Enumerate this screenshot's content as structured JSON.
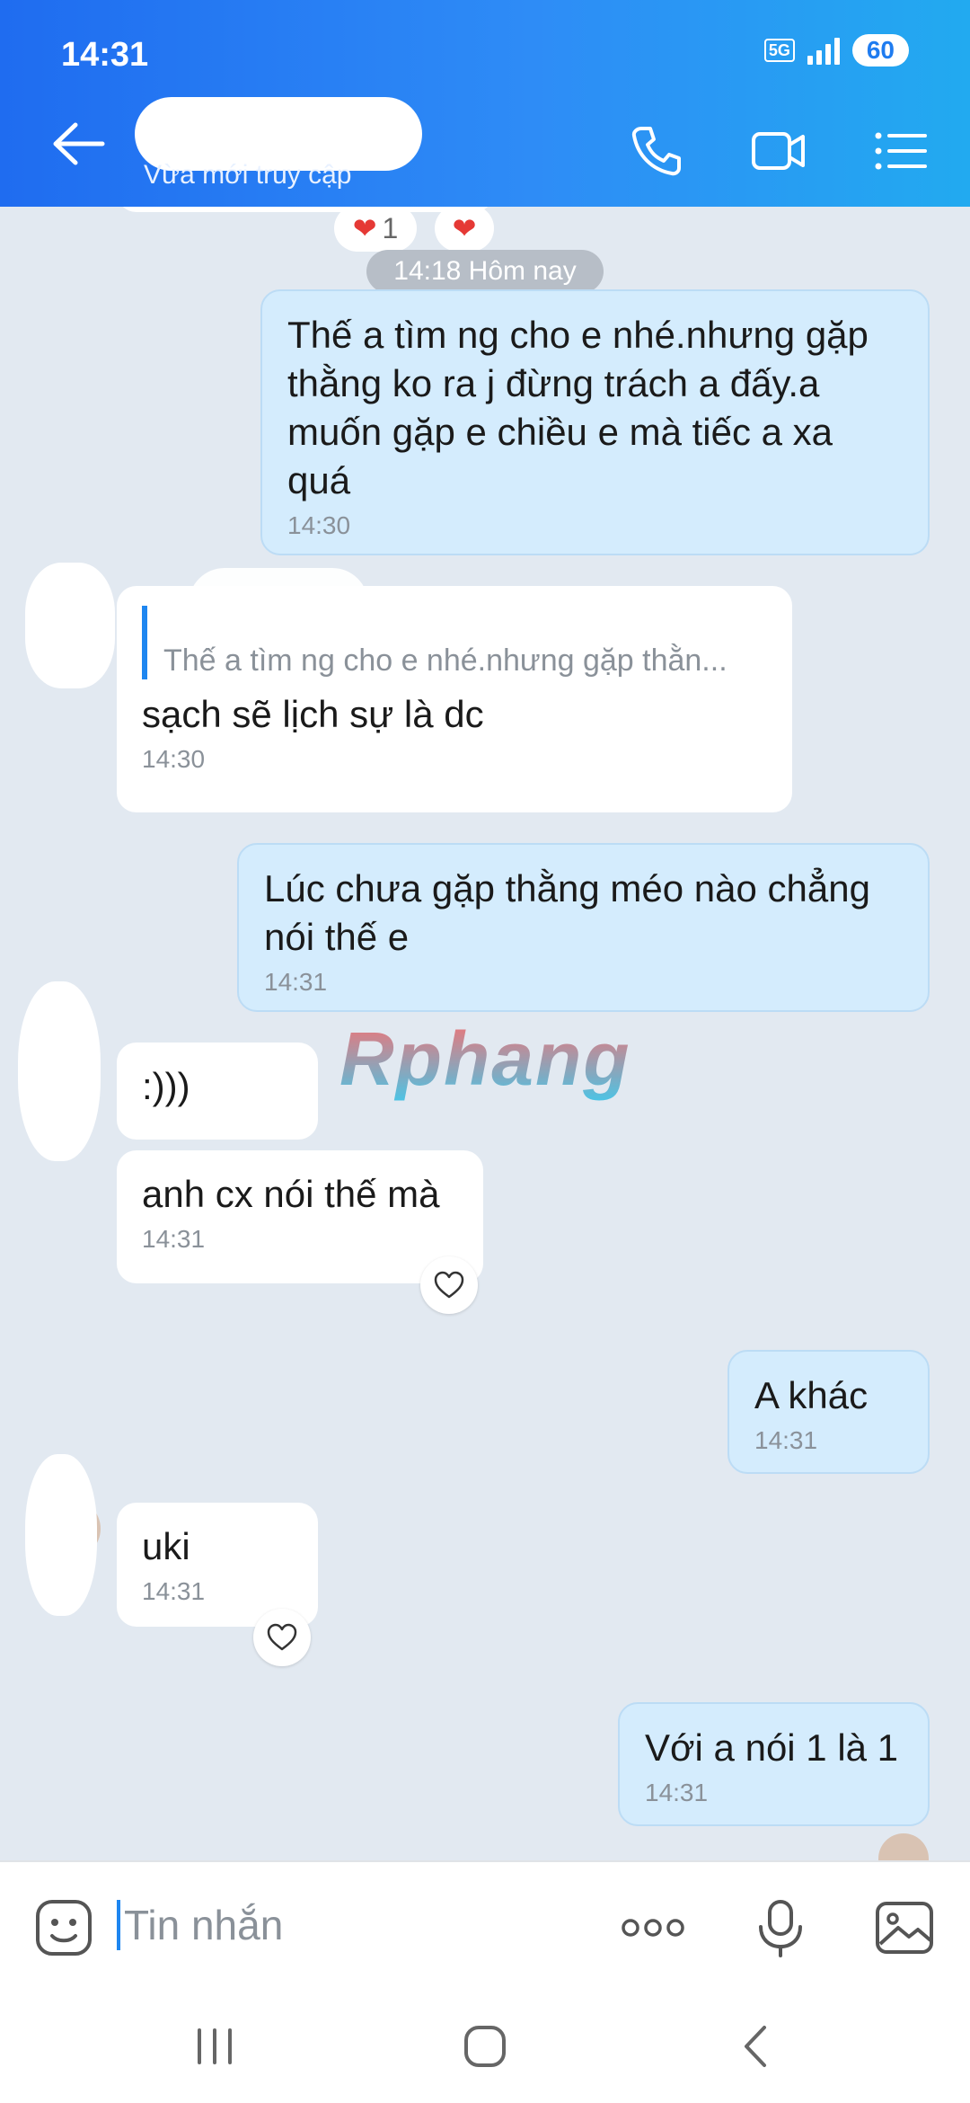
{
  "status_bar": {
    "time": "14:31",
    "network": "5G",
    "battery": "60"
  },
  "header": {
    "contact_status": "Vừa mới truy cập"
  },
  "chat": {
    "top_reactions": {
      "heart_count": "1"
    },
    "date_divider": "14:18 Hôm nay",
    "messages": [
      {
        "text": "Thế a tìm ng cho e nhé.nhưng gặp thằng ko ra j đừng trách a đấy.a muốn gặp e chiều e mà tiếc a xa quá",
        "time": "14:30"
      },
      {
        "reply_preview": "Thế a tìm ng cho e nhé.nhưng gặp thằn...",
        "text": "sạch sẽ lịch sự là dc",
        "time": "14:30"
      },
      {
        "text": "Lúc chưa gặp thằng méo nào chẳng nói thế e",
        "time": "14:31"
      },
      {
        "text": ":)))"
      },
      {
        "text": "anh cx nói thế mà",
        "time": "14:31"
      },
      {
        "text": "A khác",
        "time": "14:31"
      },
      {
        "text": "uki",
        "time": "14:31"
      },
      {
        "text": "Với a nói 1 là 1",
        "time": "14:31"
      }
    ],
    "watermark": "Rphang"
  },
  "input_bar": {
    "placeholder": "Tin nhắn"
  },
  "colors": {
    "header_start": "#1f6cf0",
    "header_end": "#22aaf0",
    "outgoing_bubble": "#d4ecfd",
    "incoming_bubble": "#ffffff",
    "accent": "#1e86f0"
  }
}
